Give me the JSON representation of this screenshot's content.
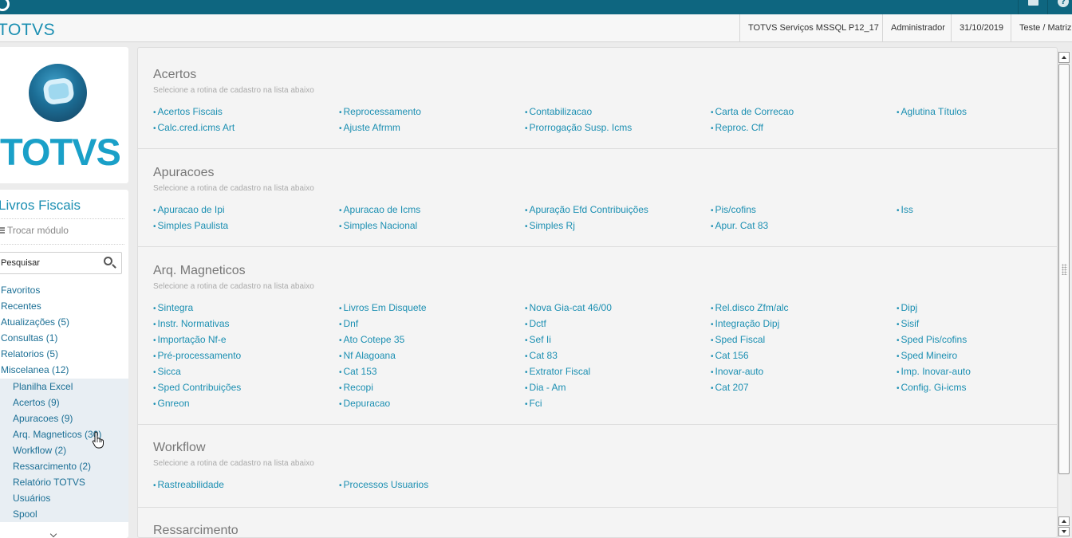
{
  "header": {
    "app_title": "TOTVS",
    "environment": "TOTVS Serviços MSSQL P12_17",
    "user": "Administrador",
    "date": "31/10/2019",
    "branch": "Teste / Matriz"
  },
  "icons": {
    "logo_mini": "totvs-logo-icon",
    "mail": "mail-icon",
    "help": "help-icon",
    "help_glyph": "?"
  },
  "sidebar": {
    "logo_text": "TOTVS",
    "module_title": "Livros Fiscais",
    "switch_module": "Trocar módulo",
    "search_placeholder": "Pesquisar",
    "menu": [
      "Favoritos",
      "Recentes",
      "Atualizações (5)",
      "Consultas (1)",
      "Relatorios (5)",
      "Miscelanea (12)"
    ],
    "submenu": [
      "Planilha Excel",
      "Acertos (9)",
      "Apuracoes (9)",
      "Arq. Magneticos (30)",
      "Workflow (2)",
      "Ressarcimento (2)",
      "Relatório TOTVS",
      "Usuários",
      "Spool"
    ]
  },
  "main": {
    "subtitle": "Selecione a rotina de cadastro na lista abaixo",
    "sections": [
      {
        "title": "Acertos",
        "items": [
          "Acertos Fiscais",
          "Reprocessamento",
          "Contabilizacao",
          "Carta de Correcao",
          "Aglutina Títulos",
          "Calc.cred.icms Art",
          "Ajuste Afrmm",
          "Prorrogação Susp. Icms",
          "Reproc. Cff"
        ]
      },
      {
        "title": "Apuracoes",
        "items": [
          "Apuracao de Ipi",
          "Apuracao de Icms",
          "Apuração Efd Contribuições",
          "Pis/cofins",
          "Iss",
          "Simples Paulista",
          "Simples Nacional",
          "Simples Rj",
          "Apur. Cat 83"
        ]
      },
      {
        "title": "Arq. Magneticos",
        "items": [
          "Sintegra",
          "Livros Em Disquete",
          "Nova Gia-cat 46/00",
          "Rel.disco Zfm/alc",
          "Dipj",
          "Instr. Normativas",
          "Dnf",
          "Dctf",
          "Integração Dipj",
          "Sisif",
          "Importação Nf-e",
          "Ato Cotepe 35",
          "Sef Ii",
          "Sped Fiscal",
          "Sped Pis/cofins",
          "Pré-processamento",
          "Nf Alagoana",
          "Cat 83",
          "Cat 156",
          "Sped Mineiro",
          "Sicca",
          "Cat 153",
          "Extrator Fiscal",
          "Inovar-auto",
          "Imp. Inovar-auto",
          "Sped Contribuições",
          "Recopi",
          "Dia - Am",
          "Cat 207",
          "Config. Gi-icms",
          "Gnreon",
          "Depuracao",
          "Fci"
        ]
      },
      {
        "title": "Workflow",
        "items": [
          "Rastreabilidade",
          "Processos Usuarios"
        ]
      },
      {
        "title": "Ressarcimento",
        "items": []
      }
    ]
  }
}
